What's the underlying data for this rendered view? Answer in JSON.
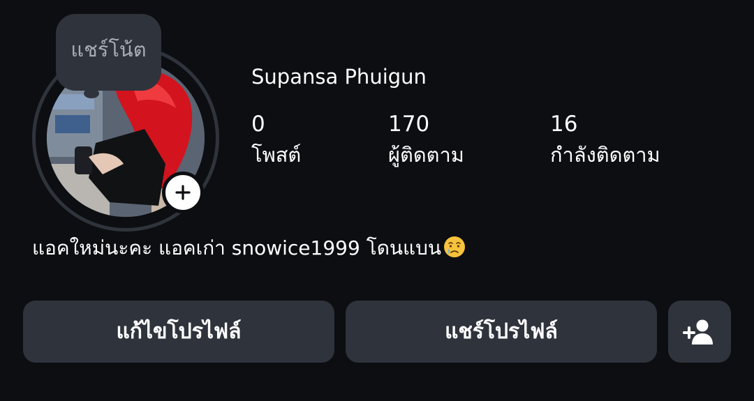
{
  "profile": {
    "name": "Supansa Phuigun",
    "note_label": "แชร์โน้ต",
    "bio": "แอคใหม่นะคะ แอคเก่า snowice1999 โดนแบน",
    "bio_emoji": "crying-face-emoji"
  },
  "stats": {
    "posts": {
      "value": "0",
      "label": "โพสต์"
    },
    "followers": {
      "value": "170",
      "label": "ผู้ติดตาม"
    },
    "following": {
      "value": "16",
      "label": "กำลังติดตาม"
    }
  },
  "buttons": {
    "edit_profile": "แก้ไขโปรไฟล์",
    "share_profile": "แชร์โปรไฟล์",
    "add_friend_icon": "add-person-icon"
  },
  "colors": {
    "background": "#0c0e12",
    "button": "#2f333b",
    "text": "#ffffff",
    "muted": "#a9adb5"
  }
}
